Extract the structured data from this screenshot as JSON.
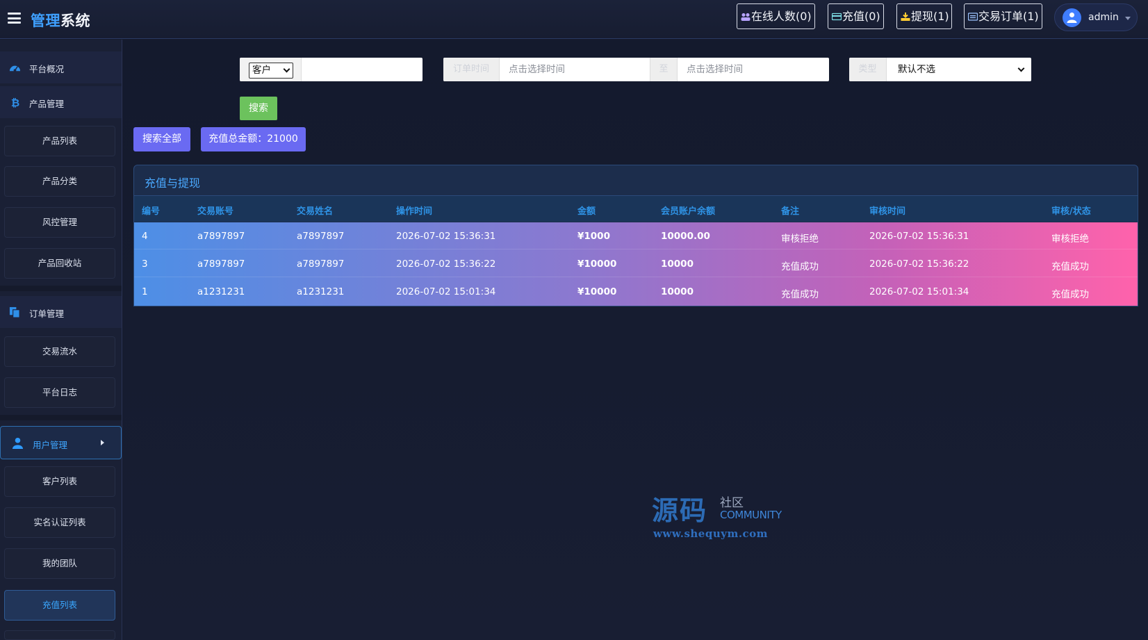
{
  "header": {
    "title_part1": "管理",
    "title_part2": "系统",
    "buttons": [
      {
        "label": "在线人数(0)"
      },
      {
        "label": "充值(0)"
      },
      {
        "label": "提现(1)"
      },
      {
        "label": "交易订单(1)"
      }
    ],
    "user": "admin"
  },
  "sidebar": {
    "groups": [
      {
        "label": "平台概况"
      },
      {
        "label": "产品管理"
      },
      {
        "label": "订单管理"
      },
      {
        "label": "用户管理"
      }
    ],
    "product_items": [
      "产品列表",
      "产品分类",
      "风控管理",
      "产品回收站"
    ],
    "order_items": [
      "交易流水",
      "平台日志"
    ],
    "user_items": [
      "客户列表",
      "实名认证列表",
      "我的团队",
      "充值列表"
    ]
  },
  "filters": {
    "account_select": "客户",
    "order_time_label": "订单时间",
    "time_placeholder": "点击选择时间",
    "to_label": "至",
    "type_label": "类型",
    "type_value": "默认不选",
    "search_button": "搜索",
    "search_all_button": "搜索全部",
    "total_label": "充值总金额：21000"
  },
  "table": {
    "title": "充值与提现",
    "headers": [
      "编号",
      "交易账号",
      "交易姓名",
      "操作时间",
      "金额",
      "会员账户余额",
      "备注",
      "审核时间",
      "审核/状态"
    ],
    "rows": [
      [
        "4",
        "a7897897",
        "a7897897",
        "2026-07-02 15:36:31",
        "¥1000",
        "10000.00",
        "审核拒绝",
        "2026-07-02 15:36:31",
        "审核拒绝"
      ],
      [
        "3",
        "a7897897",
        "a7897897",
        "2026-07-02 15:36:22",
        "¥10000",
        "10000",
        "充值成功",
        "2026-07-02 15:36:22",
        "充值成功"
      ],
      [
        "1",
        "a1231231",
        "a1231231",
        "2026-07-02 15:01:34",
        "¥10000",
        "10000",
        "充值成功",
        "2026-07-02 15:01:34",
        "充值成功"
      ]
    ]
  },
  "watermark": {
    "big": "源码",
    "small": "社区",
    "en": "COMMUNITY",
    "url": "www.shequym.com"
  },
  "icons": {
    "online": "users-icon",
    "recharge": "credit-card-icon",
    "withdraw": "download-icon",
    "orders": "list-card-icon"
  }
}
